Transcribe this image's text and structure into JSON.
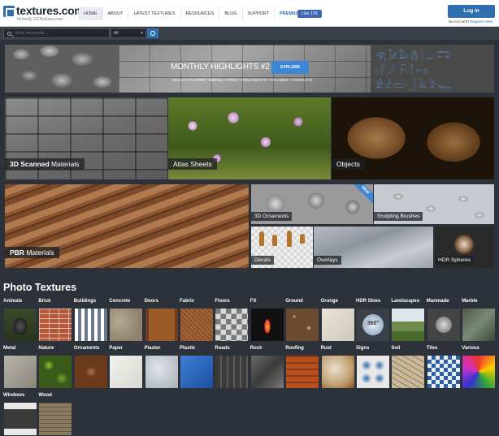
{
  "header": {
    "logo_text": "textures.com",
    "logo_sub": "formerly CGTextures.com",
    "nav": [
      "HOME",
      "ABOUT",
      "LATEST TEXTURES",
      "RESOURCES",
      "BLOG",
      "SUPPORT",
      "PREMIUM ACCESS"
    ],
    "active_nav": "HOME",
    "fb_like": "Like 17K",
    "login_label": "Log in",
    "no_account": "No Account?",
    "register": "Register Here"
  },
  "search": {
    "placeholder": "Enter Keywords...",
    "category": "All"
  },
  "banner": {
    "title": "MONTHLY HIGHLIGHTS #2",
    "subtitle": "WALLS • FLOORS • DEBRIS • PIPES • ORNAMENTS • FACADES • OVERLAYS",
    "button": "EXPLORE",
    "glyphs": [
      "𓂀𓃠𓅓𓆣𓇋𓈖𓉐",
      "𓊪𓋴𓌳𓍯𓎛𓏏𓐍",
      "𓀀𓁐𓂧𓃀𓄿𓅱𓆑"
    ]
  },
  "tiles": {
    "scanned": {
      "bold": "3D Scanned",
      "rest": " Materials"
    },
    "atlas": "Atlas Sheets",
    "objects": "Objects",
    "pbr": {
      "bold": "PBR",
      "rest": " Materials"
    },
    "ornaments": "3D Ornaments",
    "new_badge": "NEW",
    "sculpting": "Sculpting Brushes",
    "decals": "Decals",
    "overlays": "Overlays",
    "hdr_spheres": "HDR Spheres"
  },
  "photo_textures": {
    "title": "Photo Textures",
    "row1": [
      "Animals",
      "Brick",
      "Buildings",
      "Concrete",
      "Doors",
      "Fabric",
      "Floors",
      "FX",
      "Ground",
      "Grunge",
      "HDR Skies",
      "Landscapes",
      "Manmade",
      "Marble"
    ],
    "row2": [
      "Metal",
      "Nature",
      "Ornaments",
      "Paper",
      "Plaster",
      "Plastic",
      "Roads",
      "Rock",
      "Roofing",
      "Rust",
      "Signs",
      "Soil",
      "Tiles",
      "Various"
    ],
    "row3": [
      "Windows",
      "Wood"
    ],
    "hdr_label": "360°"
  },
  "colors": {
    "accent": "#2f6fb0",
    "background": "#2d3139"
  }
}
